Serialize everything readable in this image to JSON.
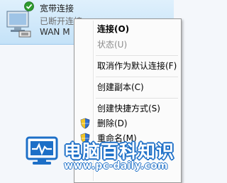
{
  "connection": {
    "title": "宽带连接",
    "status": "已断开连接",
    "device": "WAN M"
  },
  "context_menu": {
    "items": [
      {
        "label": "连接(O)",
        "bold": true,
        "disabled": false,
        "icon": ""
      },
      {
        "label": "状态(U)",
        "bold": false,
        "disabled": true,
        "icon": ""
      },
      {
        "label": "取消作为默认连接(F)",
        "bold": false,
        "disabled": false,
        "icon": ""
      },
      {
        "label": "创建副本(C)",
        "bold": false,
        "disabled": false,
        "icon": ""
      },
      {
        "label": "创建快捷方式(S)",
        "bold": false,
        "disabled": false,
        "icon": ""
      },
      {
        "label": "删除(D)",
        "bold": false,
        "disabled": false,
        "icon": "shield-icon"
      },
      {
        "label": "重命名(M)",
        "bold": false,
        "disabled": false,
        "icon": "shield-icon"
      }
    ]
  },
  "watermark": {
    "title": "电脑百科知识",
    "url": "www.pc-daily.com"
  },
  "colors": {
    "selection": "#c4e2f8",
    "menu_bg": "#fbfbfb",
    "watermark_blue": "#1d6fc7"
  }
}
